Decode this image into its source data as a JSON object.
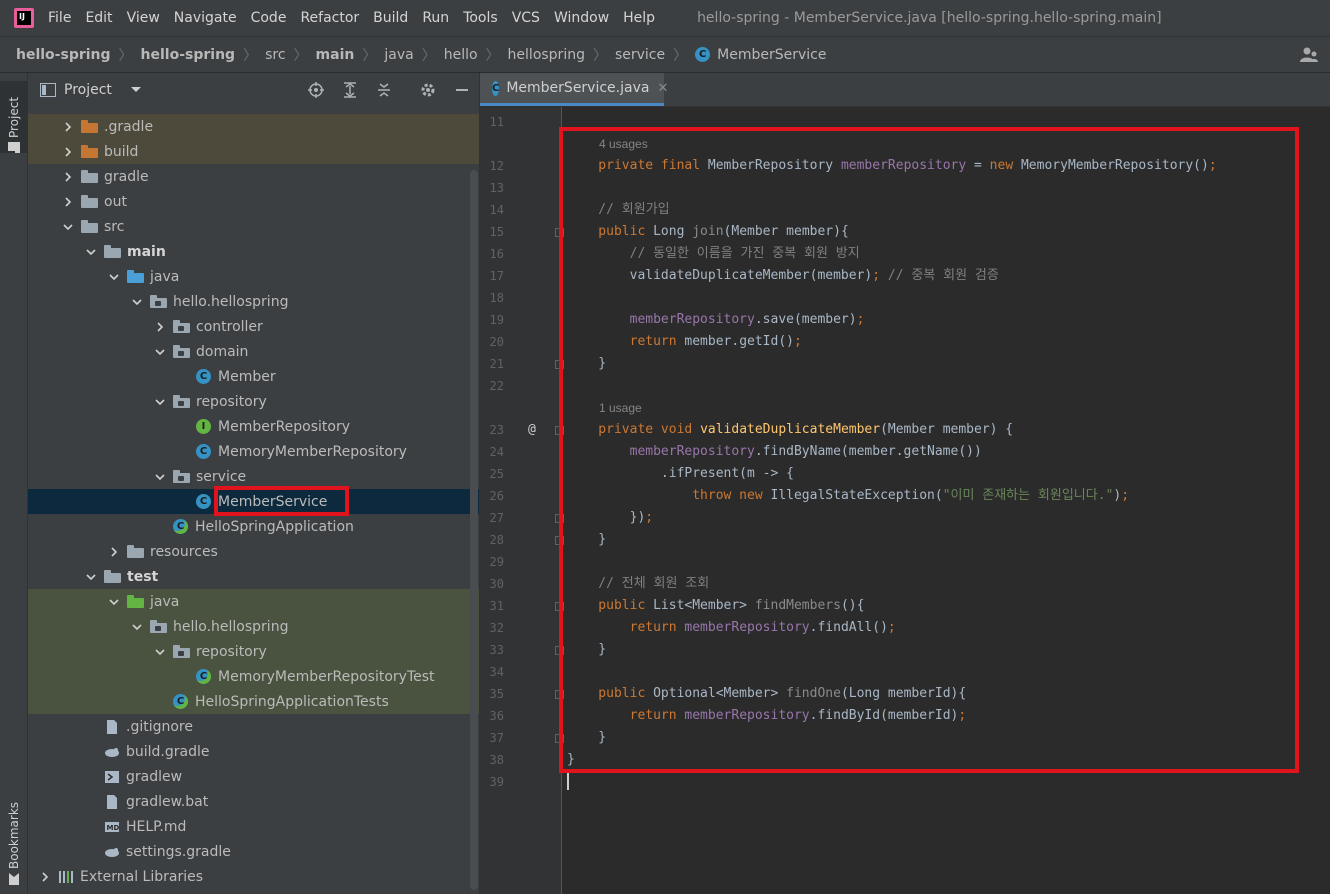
{
  "menubar": {
    "items": [
      "File",
      "Edit",
      "View",
      "Navigate",
      "Code",
      "Refactor",
      "Build",
      "Run",
      "Tools",
      "VCS",
      "Window",
      "Help"
    ],
    "window_title": "hello-spring - MemberService.java [hello-spring.hello-spring.main]"
  },
  "breadcrumb": {
    "items": [
      "hello-spring",
      "hello-spring",
      "src",
      "main",
      "java",
      "hello",
      "hellospring",
      "service",
      "MemberService"
    ]
  },
  "sidebar": {
    "project_tab": "Project",
    "bookmarks_tab": "Bookmarks"
  },
  "project_panel": {
    "title": "Project",
    "tree": [
      {
        "label": ".gradle",
        "indent": 1,
        "arrow": "right",
        "icon": "folder-orange",
        "bg": "orange"
      },
      {
        "label": "build",
        "indent": 1,
        "arrow": "right",
        "icon": "folder-orange",
        "bg": "orange"
      },
      {
        "label": "gradle",
        "indent": 1,
        "arrow": "right",
        "icon": "folder-grey"
      },
      {
        "label": "out",
        "indent": 1,
        "arrow": "right",
        "icon": "folder-grey"
      },
      {
        "label": "src",
        "indent": 1,
        "arrow": "down",
        "icon": "folder-grey"
      },
      {
        "label": "main",
        "indent": 2,
        "arrow": "down",
        "icon": "folder-grey",
        "bold": true
      },
      {
        "label": "java",
        "indent": 3,
        "arrow": "down",
        "icon": "folder-blue"
      },
      {
        "label": "hello.hellospring",
        "indent": 4,
        "arrow": "down",
        "icon": "package"
      },
      {
        "label": "controller",
        "indent": 5,
        "arrow": "right",
        "icon": "package"
      },
      {
        "label": "domain",
        "indent": 5,
        "arrow": "down",
        "icon": "package"
      },
      {
        "label": "Member",
        "indent": 6,
        "arrow": "none",
        "icon": "class"
      },
      {
        "label": "repository",
        "indent": 5,
        "arrow": "down",
        "icon": "package"
      },
      {
        "label": "MemberRepository",
        "indent": 6,
        "arrow": "none",
        "icon": "interface"
      },
      {
        "label": "MemoryMemberRepository",
        "indent": 6,
        "arrow": "none",
        "icon": "class"
      },
      {
        "label": "service",
        "indent": 5,
        "arrow": "down",
        "icon": "package"
      },
      {
        "label": "MemberService",
        "indent": 6,
        "arrow": "none",
        "icon": "class",
        "selected": true
      },
      {
        "label": "HelloSpringApplication",
        "indent": 5,
        "arrow": "none",
        "icon": "spring-class"
      },
      {
        "label": "resources",
        "indent": 3,
        "arrow": "right",
        "icon": "resources"
      },
      {
        "label": "test",
        "indent": 2,
        "arrow": "down",
        "icon": "folder-grey",
        "bold": true
      },
      {
        "label": "java",
        "indent": 3,
        "arrow": "down",
        "icon": "folder-green",
        "bg": "green"
      },
      {
        "label": "hello.hellospring",
        "indent": 4,
        "arrow": "down",
        "icon": "package",
        "bg": "green"
      },
      {
        "label": "repository",
        "indent": 5,
        "arrow": "down",
        "icon": "package",
        "bg": "green"
      },
      {
        "label": "MemoryMemberRepositoryTest",
        "indent": 6,
        "arrow": "none",
        "icon": "spring-class",
        "bg": "green"
      },
      {
        "label": "HelloSpringApplicationTests",
        "indent": 5,
        "arrow": "none",
        "icon": "spring-class",
        "bg": "green"
      },
      {
        "label": ".gitignore",
        "indent": 2,
        "arrow": "none",
        "icon": "file"
      },
      {
        "label": "build.gradle",
        "indent": 2,
        "arrow": "none",
        "icon": "gradle"
      },
      {
        "label": "gradlew",
        "indent": 2,
        "arrow": "none",
        "icon": "exec"
      },
      {
        "label": "gradlew.bat",
        "indent": 2,
        "arrow": "none",
        "icon": "file"
      },
      {
        "label": "HELP.md",
        "indent": 2,
        "arrow": "none",
        "icon": "md"
      },
      {
        "label": "settings.gradle",
        "indent": 2,
        "arrow": "none",
        "icon": "gradle"
      },
      {
        "label": "External Libraries",
        "indent": 0,
        "arrow": "right",
        "icon": "libraries"
      }
    ]
  },
  "editor": {
    "tab_label": "MemberService.java",
    "lines": [
      {
        "num": "11",
        "tokens": []
      },
      {
        "hint": "4 usages"
      },
      {
        "num": "12",
        "tokens": [
          [
            "kw",
            "    private final "
          ],
          [
            "df",
            "MemberRepository "
          ],
          [
            "fld",
            "memberRepository"
          ],
          [
            "df",
            " = "
          ],
          [
            "kw",
            "new "
          ],
          [
            "df",
            "MemoryMemberRepository()"
          ],
          [
            "kw",
            ";"
          ]
        ]
      },
      {
        "num": "13",
        "tokens": []
      },
      {
        "num": "14",
        "tokens": [
          [
            "cm",
            "    // 회원가입"
          ]
        ]
      },
      {
        "num": "15",
        "tokens": [
          [
            "kw",
            "    public "
          ],
          [
            "df",
            "Long "
          ],
          [
            "muted",
            "join"
          ],
          [
            "df",
            "(Member member){"
          ]
        ]
      },
      {
        "num": "16",
        "tokens": [
          [
            "cm",
            "        // 동일한 이름을 가진 중복 회원 방지"
          ]
        ]
      },
      {
        "num": "17",
        "tokens": [
          [
            "df",
            "        validateDuplicateMember(member)"
          ],
          [
            "kw",
            "; "
          ],
          [
            "cm",
            "// 중복 회원 검증"
          ]
        ]
      },
      {
        "num": "18",
        "tokens": []
      },
      {
        "num": "19",
        "tokens": [
          [
            "fld",
            "        memberRepository"
          ],
          [
            "df",
            ".save(member)"
          ],
          [
            "kw",
            ";"
          ]
        ]
      },
      {
        "num": "20",
        "tokens": [
          [
            "kw",
            "        return "
          ],
          [
            "df",
            "member.getId()"
          ],
          [
            "kw",
            ";"
          ]
        ]
      },
      {
        "num": "21",
        "tokens": [
          [
            "df",
            "    }"
          ]
        ]
      },
      {
        "num": "22",
        "tokens": []
      },
      {
        "hint": "1 usage"
      },
      {
        "num": "23",
        "tokens": [
          [
            "kw",
            "    private void "
          ],
          [
            "fn",
            "validateDuplicateMember"
          ],
          [
            "df",
            "(Member member) {"
          ]
        ],
        "at": true
      },
      {
        "num": "24",
        "tokens": [
          [
            "fld",
            "        memberRepository"
          ],
          [
            "df",
            ".findByName(member.getName())"
          ]
        ]
      },
      {
        "num": "25",
        "tokens": [
          [
            "df",
            "            .ifPresent(m -> {"
          ]
        ]
      },
      {
        "num": "26",
        "tokens": [
          [
            "kw",
            "                throw new "
          ],
          [
            "df",
            "IllegalStateException("
          ],
          [
            "str",
            "\"이미 존재하는 회원입니다.\""
          ],
          [
            "df",
            ")"
          ],
          [
            "kw",
            ";"
          ]
        ]
      },
      {
        "num": "27",
        "tokens": [
          [
            "df",
            "        })"
          ],
          [
            "kw",
            ";"
          ]
        ]
      },
      {
        "num": "28",
        "tokens": [
          [
            "df",
            "    }"
          ]
        ]
      },
      {
        "num": "29",
        "tokens": []
      },
      {
        "num": "30",
        "tokens": [
          [
            "cm",
            "    // 전체 회원 조회"
          ]
        ]
      },
      {
        "num": "31",
        "tokens": [
          [
            "kw",
            "    public "
          ],
          [
            "df",
            "List<Member> "
          ],
          [
            "muted",
            "findMembers"
          ],
          [
            "df",
            "(){"
          ]
        ]
      },
      {
        "num": "32",
        "tokens": [
          [
            "kw",
            "        return "
          ],
          [
            "fld",
            "memberRepository"
          ],
          [
            "df",
            ".findAll()"
          ],
          [
            "kw",
            ";"
          ]
        ]
      },
      {
        "num": "33",
        "tokens": [
          [
            "df",
            "    }"
          ]
        ]
      },
      {
        "num": "34",
        "tokens": []
      },
      {
        "num": "35",
        "tokens": [
          [
            "kw",
            "    public "
          ],
          [
            "df",
            "Optional<Member> "
          ],
          [
            "muted",
            "findOne"
          ],
          [
            "df",
            "(Long memberId){"
          ]
        ]
      },
      {
        "num": "36",
        "tokens": [
          [
            "kw",
            "        return "
          ],
          [
            "fld",
            "memberRepository"
          ],
          [
            "df",
            ".findById(memberId)"
          ],
          [
            "kw",
            ";"
          ]
        ]
      },
      {
        "num": "37",
        "tokens": [
          [
            "df",
            "    }"
          ]
        ]
      },
      {
        "num": "38",
        "tokens": [
          [
            "df",
            "}"
          ]
        ]
      },
      {
        "num": "39",
        "tokens": []
      }
    ]
  },
  "colors": {
    "highlight_box": "#e1141e",
    "keyword": "#cc7832",
    "field": "#9876aa",
    "method_decl": "#ffc66d",
    "string": "#6a8759",
    "comment": "#808080"
  }
}
